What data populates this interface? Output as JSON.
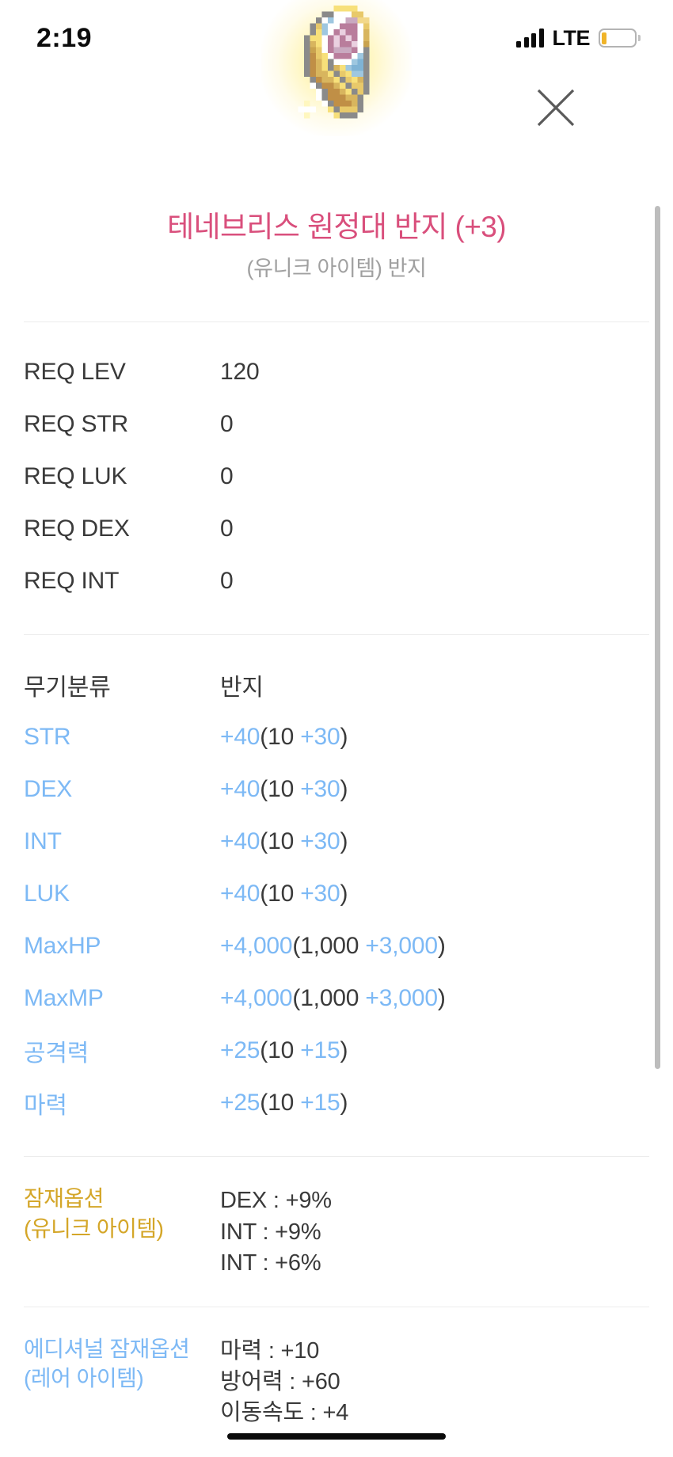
{
  "status_bar": {
    "time": "2:19",
    "network_label": "LTE",
    "signal_icon": "signal-bars-icon",
    "battery_icon": "battery-low-icon"
  },
  "header": {
    "item_icon": "ring-item-icon",
    "close_icon": "close-x-icon"
  },
  "item": {
    "title": "테네브리스 원정대 반지 (+3)",
    "subtitle": "(유니크 아이템) 반지",
    "title_color": "#d94f7c",
    "subtitle_color": "#a0a0a0"
  },
  "requirements": [
    {
      "label": "REQ LEV",
      "value": "120"
    },
    {
      "label": "REQ STR",
      "value": "0"
    },
    {
      "label": "REQ LUK",
      "value": "0"
    },
    {
      "label": "REQ DEX",
      "value": "0"
    },
    {
      "label": "REQ INT",
      "value": "0"
    }
  ],
  "category": {
    "label": "무기분류",
    "value": "반지"
  },
  "stats": [
    {
      "label": "STR",
      "total": "+40",
      "base": "(10 ",
      "bonus": "+30",
      "close": ")"
    },
    {
      "label": "DEX",
      "total": "+40",
      "base": "(10 ",
      "bonus": "+30",
      "close": ")"
    },
    {
      "label": "INT",
      "total": "+40",
      "base": "(10 ",
      "bonus": "+30",
      "close": ")"
    },
    {
      "label": "LUK",
      "total": "+40",
      "base": "(10 ",
      "bonus": "+30",
      "close": ")"
    },
    {
      "label": "MaxHP",
      "total": "+4,000",
      "base": "(1,000 ",
      "bonus": "+3,000",
      "close": ")"
    },
    {
      "label": "MaxMP",
      "total": "+4,000",
      "base": "(1,000 ",
      "bonus": "+3,000",
      "close": ")"
    },
    {
      "label": "공격력",
      "total": "+25",
      "base": "(10 ",
      "bonus": "+15",
      "close": ")"
    },
    {
      "label": "마력",
      "total": "+25",
      "base": "(10 ",
      "bonus": "+15",
      "close": ")"
    }
  ],
  "potential": {
    "label_line1": "잠재옵션",
    "label_line2": "(유니크 아이템)",
    "label_color": "#d4a628",
    "options": [
      "DEX : +9%",
      "INT : +9%",
      "INT : +6%"
    ]
  },
  "additional_potential": {
    "label_line1": "에디셔널 잠재옵션",
    "label_line2": "(레어 아이템)",
    "label_color": "#7db9f5",
    "options": [
      "마력 : +10",
      "방어력 : +60",
      "이동속도 : +4"
    ]
  },
  "colors": {
    "stat_blue": "#7db9f5",
    "text_dark": "#3a3a3a",
    "divider": "#ececec",
    "scrollbar": "#bdbdbd"
  }
}
